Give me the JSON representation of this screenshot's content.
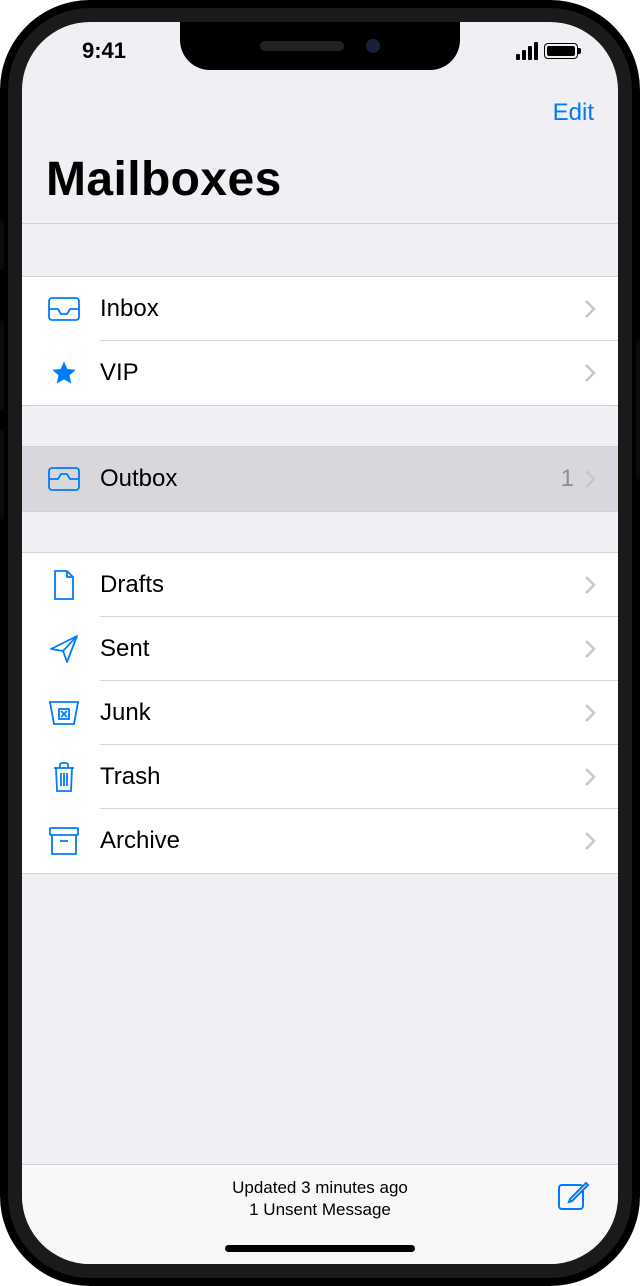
{
  "status": {
    "time": "9:41"
  },
  "nav": {
    "edit_label": "Edit"
  },
  "title": "Mailboxes",
  "section1": [
    {
      "label": "Inbox"
    },
    {
      "label": "VIP"
    }
  ],
  "section2": [
    {
      "label": "Outbox",
      "count": "1"
    }
  ],
  "section3": [
    {
      "label": "Drafts"
    },
    {
      "label": "Sent"
    },
    {
      "label": "Junk"
    },
    {
      "label": "Trash"
    },
    {
      "label": "Archive"
    }
  ],
  "toolbar": {
    "status_line1": "Updated 3 minutes ago",
    "status_line2": "1 Unsent Message"
  }
}
